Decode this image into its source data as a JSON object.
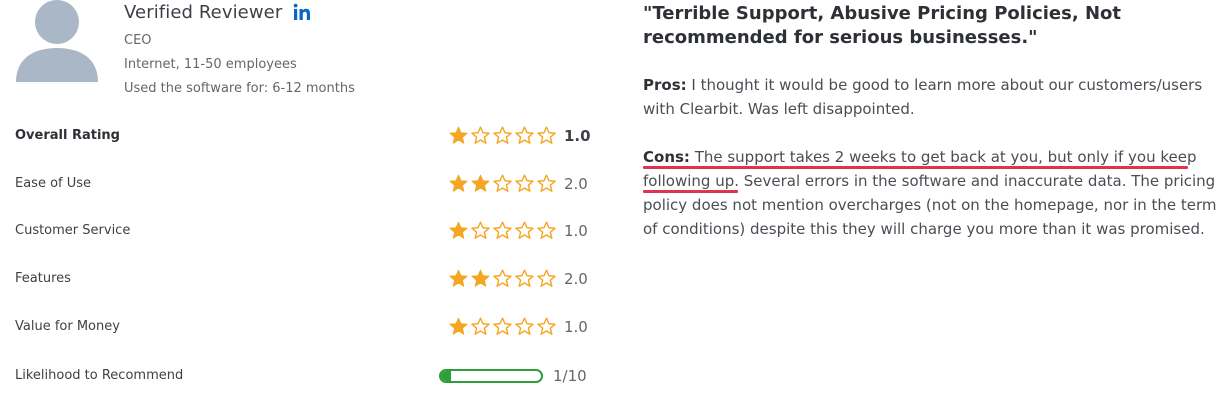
{
  "reviewer": {
    "name": "Verified Reviewer",
    "title": "CEO",
    "company": "Internet, 11-50 employees",
    "usage": "Used the software for: 6-12 months",
    "linkedin_icon": "linkedin-icon"
  },
  "ratings": [
    {
      "label": "Overall Rating",
      "value": "1.0",
      "stars": 1,
      "bold": true
    },
    {
      "label": "Ease of Use",
      "value": "2.0",
      "stars": 2,
      "bold": false
    },
    {
      "label": "Customer Service",
      "value": "1.0",
      "stars": 1,
      "bold": false
    },
    {
      "label": "Features",
      "value": "2.0",
      "stars": 2,
      "bold": false
    },
    {
      "label": "Value for Money",
      "value": "1.0",
      "stars": 1,
      "bold": false
    }
  ],
  "recommend": {
    "label": "Likelihood to Recommend",
    "value": "1/10",
    "fraction": 0.1
  },
  "review": {
    "title": "\"Terrible Support, Abusive Pricing Policies, Not recommended for serious businesses.\"",
    "pros_label": "Pros:",
    "pros_text": " I thought it would be good to learn more about our customers/users with Clearbit. Was left disappointed.",
    "cons_label": "Cons:",
    "cons_text": " The support takes 2 weeks to get back at you, but only if you keep following up. Several errors in the software and inaccurate data. The pricing policy does not mention overcharges (not on the homepage, nor in the term of conditions) despite this they will charge you more than it was promised."
  },
  "colors": {
    "star_filled": "#f5a623",
    "star_empty": "#f5a623",
    "progress": "#2e9e3a",
    "highlight_underline": "#e0334f",
    "avatar": "#a9b7c6"
  }
}
